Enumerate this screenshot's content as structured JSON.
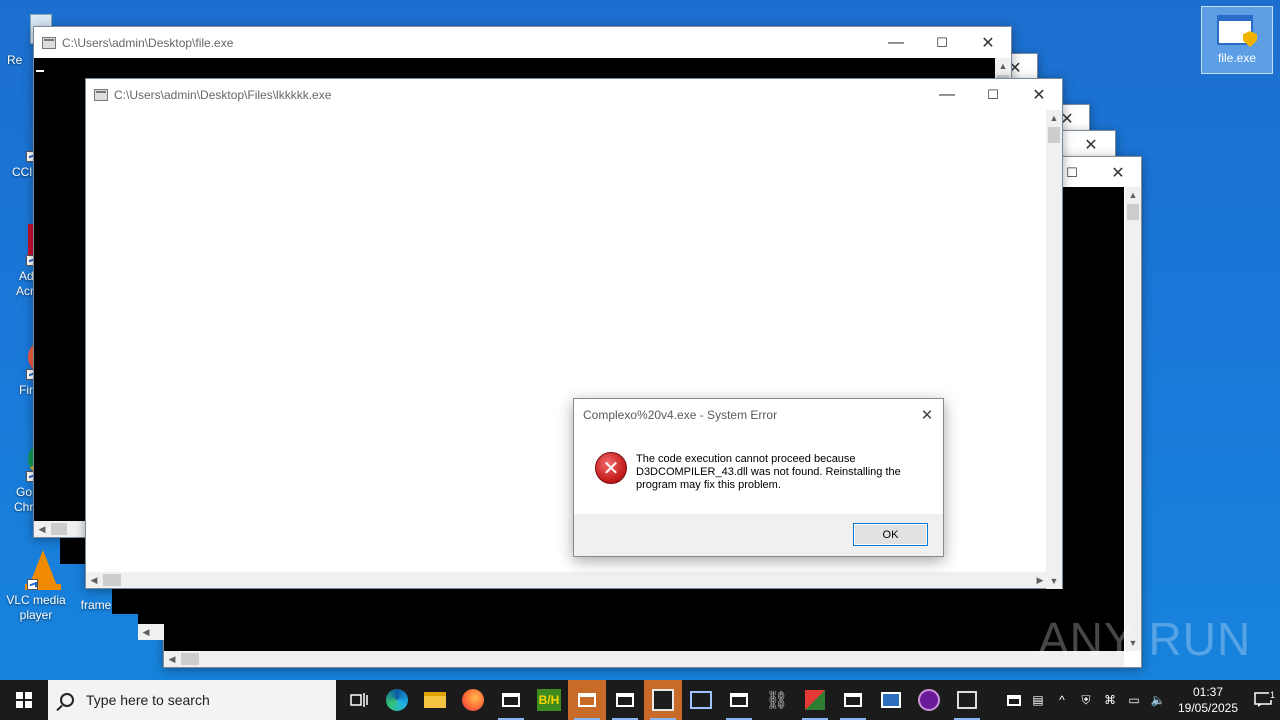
{
  "desktop": {
    "icons": [
      {
        "label": "Re"
      },
      {
        "label": "CCl"
      },
      {
        "label": "Ad"
      },
      {
        "label": "Acr"
      },
      {
        "label": "Fir"
      },
      {
        "label": "Go"
      },
      {
        "label": "Chr"
      },
      {
        "label": "VLC media player"
      },
      {
        "label": "frame"
      }
    ],
    "selected_icon": {
      "label": "file.exe"
    }
  },
  "windows": {
    "back": {
      "title": "C:\\Users\\admin\\Desktop\\file.exe"
    },
    "front": {
      "title": "C:\\Users\\admin\\Desktop\\Files\\lkkkkk.exe"
    }
  },
  "dialog": {
    "title": "Complexo%20v4.exe - System Error",
    "message": "The code execution cannot proceed because D3DCOMPILER_43.dll was not found. Reinstalling the program may fix this problem.",
    "ok_label": "OK"
  },
  "taskbar": {
    "search_placeholder": "Type here to search",
    "time": "01:37",
    "date": "19/05/2025",
    "notification_count": "1"
  },
  "watermark": "ANY RUN"
}
